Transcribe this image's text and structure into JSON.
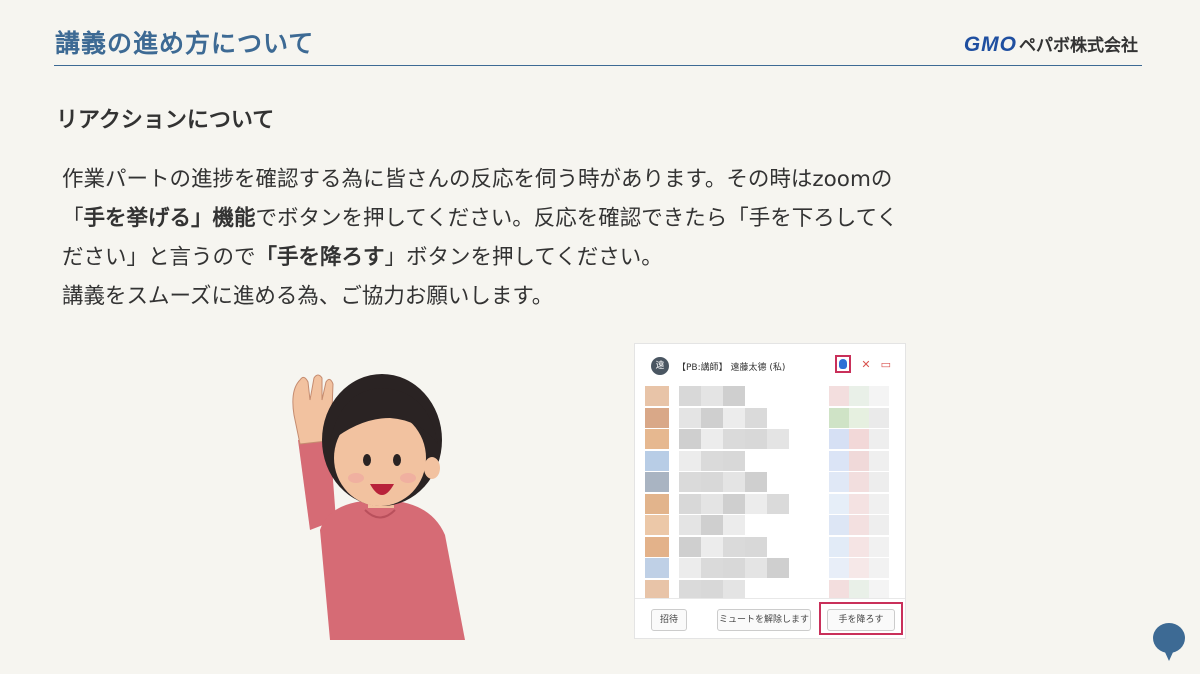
{
  "header": {
    "title": "講義の進め方について",
    "brand_gmo": "GMO",
    "brand_rest": "ペパボ株式会社"
  },
  "section": {
    "heading": "リアクションについて"
  },
  "body": {
    "line1": "作業パートの進捗を確認する為に皆さんの反応を伺う時があります。その時はzoomの",
    "line2_open": "「",
    "line2_bold": "手を挙げる」機能",
    "line2_rest": "でボタンを押してください。反応を確認できたら「手を下ろしてく",
    "line3_pre": "ださい」と言うので",
    "line3_bold": "「手を降ろす",
    "line3_post": "」ボタンを押してください。",
    "line4": "講義をスムーズに進める為、ご協力お願いします。"
  },
  "panel": {
    "avatar_text": "遠",
    "self_name": "【PB:講師】 遠藤太德 (私)",
    "icons": [
      "raised-hand-icon",
      "mic-off-icon",
      "video-off-icon"
    ],
    "footer": {
      "invite": "招待",
      "unmute_all": "ミュートを解除します",
      "lower_hand": "手を降ろす"
    },
    "highlight_color": "#c9305a"
  },
  "colors": {
    "title": "#3d6a94",
    "brand": "#1f4fa0",
    "background": "#f6f5f0",
    "highlight": "#c9305a"
  }
}
